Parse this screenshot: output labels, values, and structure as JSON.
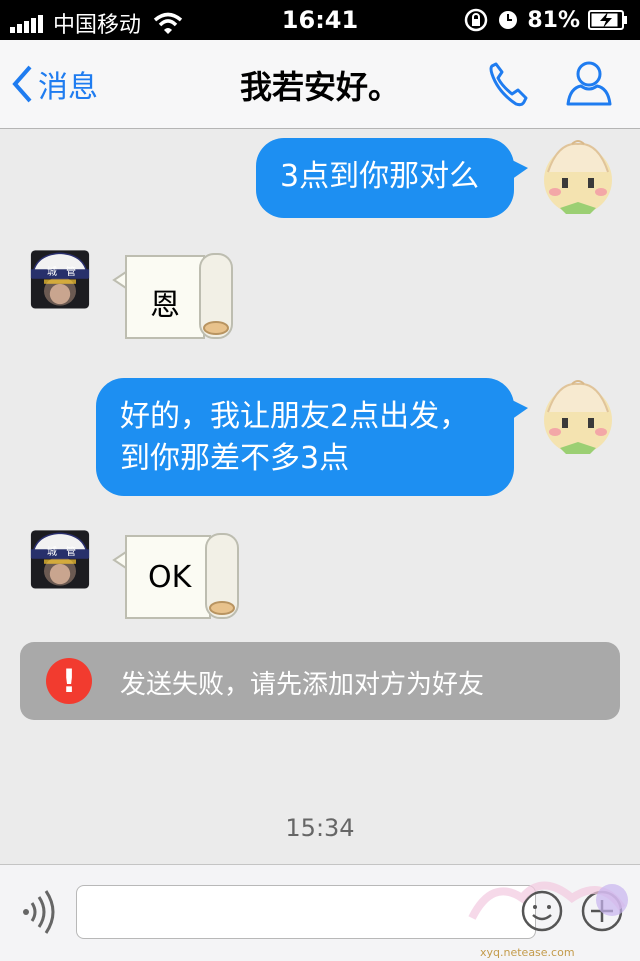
{
  "status_bar": {
    "carrier": "中国移动",
    "time": "16:41",
    "battery": "81%"
  },
  "nav": {
    "back_label": "消息",
    "title": "我若安好。",
    "icons": [
      "phone-icon",
      "contact-icon"
    ]
  },
  "messages": [
    {
      "sender": "me",
      "type": "text",
      "lines": [
        "3点到你那对么"
      ]
    },
    {
      "sender": "other",
      "type": "scroll",
      "text": "恩"
    },
    {
      "sender": "me",
      "type": "text",
      "lines": [
        "好的，我让朋友2点出发，",
        "到你那差不多3点"
      ]
    },
    {
      "sender": "other",
      "type": "scroll",
      "text": "OK"
    }
  ],
  "avatar_badge": {
    "left": "城",
    "right": "管"
  },
  "notice": {
    "icon_glyph": "!",
    "text": "发送失败，请先添加对方为好友"
  },
  "timestamp": "15:34",
  "input": {
    "placeholder": "",
    "watermark": "xyq.netease.com"
  },
  "colors": {
    "bubble_blue": "#1d8ff2",
    "accent": "#1f7cf0",
    "notice_bg": "#a9a9a9",
    "error_red": "#f23b2f"
  }
}
